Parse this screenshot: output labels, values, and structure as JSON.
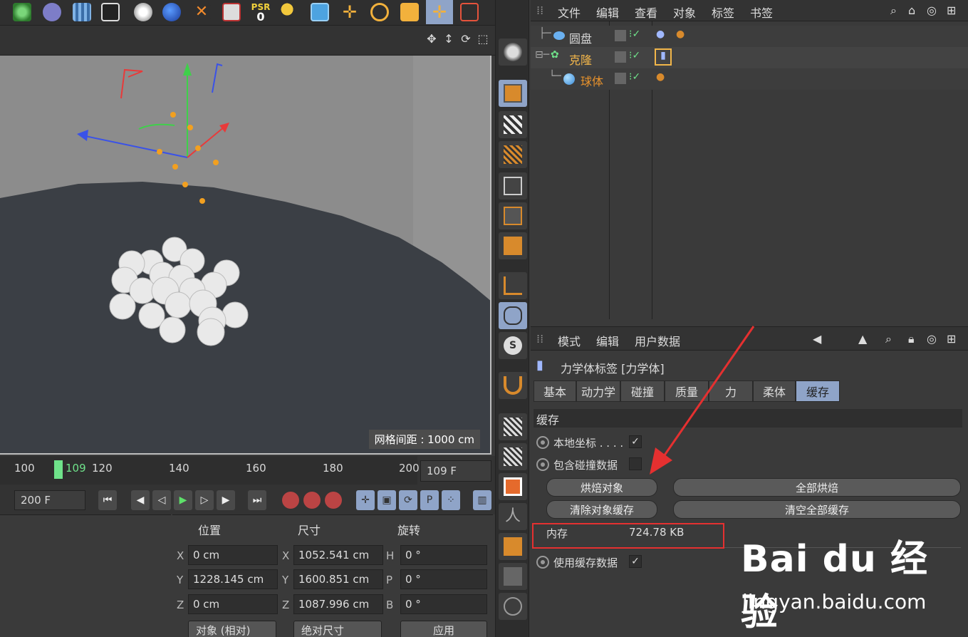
{
  "viewport": {
    "grid_spacing_label": "网格间距 : 1000 cm"
  },
  "timeline": {
    "ticks": [
      "100",
      "109",
      "120",
      "140",
      "160",
      "180",
      "200"
    ],
    "current_frame": "109 F",
    "end_frame": "200 F"
  },
  "object_manager": {
    "menu": [
      "文件",
      "编辑",
      "查看",
      "对象",
      "标签",
      "书签"
    ],
    "objects": [
      {
        "name": "圆盘",
        "color": "#d8d8d8"
      },
      {
        "name": "克隆",
        "color": "#f2b64a"
      },
      {
        "name": "球体",
        "color": "#e8922c"
      }
    ]
  },
  "attribute_manager": {
    "menu": [
      "模式",
      "编辑",
      "用户数据"
    ],
    "title": "力学体标签 [力学体]",
    "tabs": [
      "基本",
      "动力学",
      "碰撞",
      "质量",
      "力",
      "柔体",
      "缓存"
    ],
    "active_tab": "缓存",
    "section": "缓存",
    "local_coords_label": "本地坐标 . . . .",
    "include_collision_label": "包含碰撞数据",
    "bake_object": "烘焙对象",
    "bake_all": "全部烘焙",
    "clear_object_cache": "清除对象缓存",
    "clear_all_cache": "清空全部缓存",
    "memory_label": "内存",
    "memory_value": "724.78 KB",
    "use_cache_label": "使用缓存数据"
  },
  "coordinates": {
    "headers": {
      "position": "位置",
      "size": "尺寸",
      "rotation": "旋转"
    },
    "pos": {
      "x": "0 cm",
      "y": "1228.145 cm",
      "z": "0 cm"
    },
    "size": {
      "x": "1052.541 cm",
      "y": "1600.851 cm",
      "z": "1087.996 cm"
    },
    "rot": {
      "h": "0 °",
      "p": "0 °",
      "b": "0 °"
    },
    "axis_labels": {
      "x": "X",
      "y": "Y",
      "z": "Z",
      "h": "H",
      "p": "P",
      "b": "B"
    },
    "mode_dropdown": "对象 (相对)",
    "size_dropdown": "绝对尺寸",
    "apply_button": "应用"
  },
  "toolbar": {
    "psr_label": "PSR",
    "psr_value": "0"
  },
  "watermark": {
    "logo": "Bai du 经验",
    "url": "jingyan.baidu.com"
  }
}
